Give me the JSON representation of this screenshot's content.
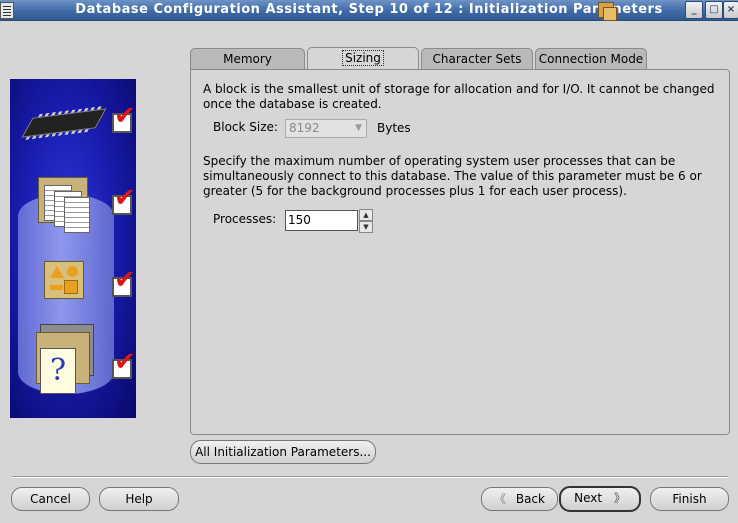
{
  "window": {
    "title": "Database Configuration Assistant, Step 10 of 12 : Initialization Parameters",
    "minimize_glyph": "_",
    "maximize_glyph": "□",
    "close_glyph": "×"
  },
  "tabs": [
    {
      "label": "Memory",
      "active": false
    },
    {
      "label": "Sizing",
      "active": true
    },
    {
      "label": "Character Sets",
      "active": false
    },
    {
      "label": "Connection Mode",
      "active": false
    }
  ],
  "sizing": {
    "block_desc_line1": "A block is the smallest unit of storage for allocation and for I/O. It cannot be changed",
    "block_desc_line2": "once the database is created.",
    "block_size_label": "Block Size:",
    "block_size_value": "8192",
    "block_size_unit": "Bytes",
    "proc_desc_line1": "Specify the maximum number of operating system user processes that can be",
    "proc_desc_line2": "simultaneously connect to this database. The value of this parameter must be 6 or",
    "proc_desc_line3": "greater (5 for the background processes plus 1 for each user process).",
    "processes_label": "Processes:",
    "processes_value": "150"
  },
  "all_params_button": "All Initialization Parameters...",
  "footer": {
    "cancel": "Cancel",
    "help": "Help",
    "back": "Back",
    "back_glyph": "《",
    "next": "Next",
    "next_glyph": "》",
    "finish": "Finish"
  },
  "illustration": {
    "icons": [
      "memory-chip-icon",
      "documents-icon",
      "shapes-icon",
      "help-document-icon"
    ],
    "help_glyph": "?",
    "check_glyph": "✔",
    "check_color": "#d81818",
    "background_color": "#1a1db0"
  }
}
